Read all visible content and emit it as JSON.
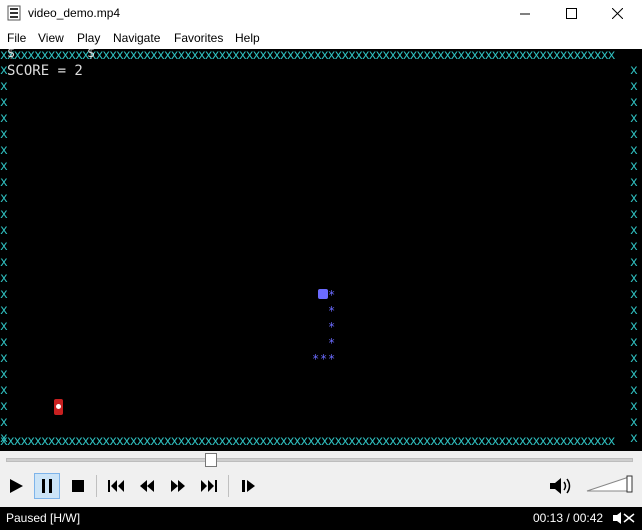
{
  "window": {
    "title": "video_demo.mp4"
  },
  "menu": {
    "items": [
      "File",
      "View",
      "Play",
      "Navigate",
      "Favorites",
      "Help"
    ]
  },
  "game": {
    "score_text": "SCORE = 2",
    "border_char": "x",
    "marker_char": "$",
    "snake_segment_char": "*"
  },
  "status": {
    "state": "Paused [H/W]",
    "time": "00:13 / 00:42"
  },
  "colors": {
    "video_bg": "#000000",
    "border": "#2fbfbf",
    "snake": "#6b6bff",
    "food": "#c82020"
  }
}
